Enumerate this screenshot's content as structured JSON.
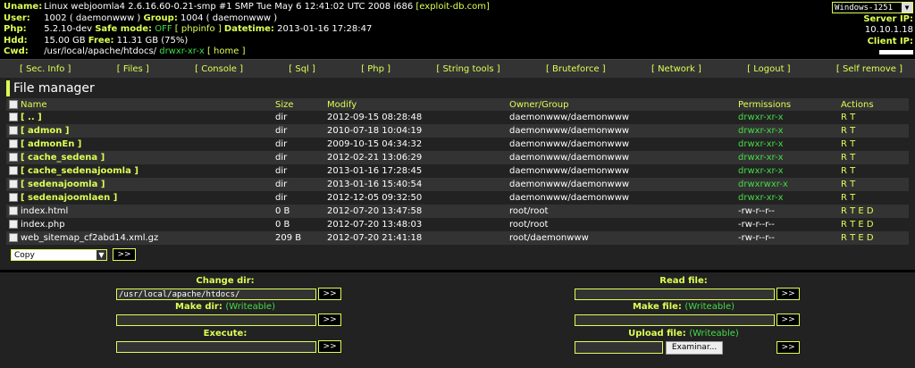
{
  "header": {
    "uname_label": "Uname:",
    "uname_value": "Linux webjoomla4 2.6.16.60-0.21-smp #1 SMP Tue May 6 12:41:02 UTC 2008 i686",
    "uname_link": "[exploit-db.com]",
    "user_label": "User:",
    "user_value": "1002 ( daemonwww )",
    "group_label": "Group:",
    "group_value": "1004 ( daemonwww )",
    "php_label": "Php:",
    "php_value": "5.2.10-dev",
    "safemode_label": "Safe mode:",
    "safemode_value": "OFF",
    "phpinfo_link": "[ phpinfo ]",
    "datetime_label": "Datetime:",
    "datetime_value": "2013-01-16 17:28:47",
    "hdd_label": "Hdd:",
    "hdd_total": "15.00 GB",
    "free_label": "Free:",
    "hdd_free": "11.31 GB (75%)",
    "cwd_label": "Cwd:",
    "cwd_path": "/usr/local/apache/htdocs/",
    "cwd_perms": "drwxr-xr-x",
    "home_link": "[ home ]",
    "charset": "Windows-1251",
    "server_ip_label": "Server IP:",
    "server_ip": "10.10.1.18",
    "client_ip_label": "Client IP:"
  },
  "menu": [
    "[ Sec. Info ]",
    "[ Files ]",
    "[ Console ]",
    "[ Sql ]",
    "[ Php ]",
    "[ String tools ]",
    "[ Bruteforce ]",
    "[ Network ]",
    "[ Logout ]",
    "[ Self remove ]"
  ],
  "file_manager": {
    "title": "File manager",
    "columns": [
      "Name",
      "Size",
      "Modify",
      "Owner/Group",
      "Permissions",
      "Actions"
    ],
    "rows": [
      {
        "name": "[ .. ]",
        "type": "dir",
        "size": "dir",
        "modify": "2012-09-15 08:28:48",
        "owner": "daemonwww/daemonwww",
        "perms": "drwxr-xr-x",
        "actions": "R T"
      },
      {
        "name": "[ admon ]",
        "type": "dir",
        "size": "dir",
        "modify": "2010-07-18 10:04:19",
        "owner": "daemonwww/daemonwww",
        "perms": "drwxr-xr-x",
        "actions": "R T"
      },
      {
        "name": "[ admonEn ]",
        "type": "dir",
        "size": "dir",
        "modify": "2009-10-15 04:34:32",
        "owner": "daemonwww/daemonwww",
        "perms": "drwxr-xr-x",
        "actions": "R T"
      },
      {
        "name": "[ cache_sedena ]",
        "type": "dir",
        "size": "dir",
        "modify": "2012-02-21 13:06:29",
        "owner": "daemonwww/daemonwww",
        "perms": "drwxr-xr-x",
        "actions": "R T"
      },
      {
        "name": "[ cache_sedenajoomla ]",
        "type": "dir",
        "size": "dir",
        "modify": "2013-01-16 17:28:45",
        "owner": "daemonwww/daemonwww",
        "perms": "drwxr-xr-x",
        "actions": "R T"
      },
      {
        "name": "[ sedenajoomla ]",
        "type": "dir",
        "size": "dir",
        "modify": "2013-01-16 15:40:54",
        "owner": "daemonwww/daemonwww",
        "perms": "drwxrwxr-x",
        "actions": "R T"
      },
      {
        "name": "[ sedenajoomlaen ]",
        "type": "dir",
        "size": "dir",
        "modify": "2012-12-05 09:32:50",
        "owner": "daemonwww/daemonwww",
        "perms": "drwxr-xr-x",
        "actions": "R T"
      },
      {
        "name": "index.html",
        "type": "file",
        "size": "0 B",
        "modify": "2012-07-20 13:47:58",
        "owner": "root/root",
        "perms": "-rw-r--r--",
        "actions": "R T E D"
      },
      {
        "name": "index.php",
        "type": "file",
        "size": "0 B",
        "modify": "2012-07-20 13:48:03",
        "owner": "root/root",
        "perms": "-rw-r--r--",
        "actions": "R T E D"
      },
      {
        "name": "web_sitemap_cf2abd14.xml.gz",
        "type": "file",
        "size": "209 B",
        "modify": "2012-07-20 21:41:18",
        "owner": "root/daemonwww",
        "perms": "-rw-r--r--",
        "actions": "R T E D"
      }
    ],
    "action_select": "Copy",
    "submit_label": ">>"
  },
  "forms": {
    "change_dir_label": "Change dir:",
    "change_dir_value": "/usr/local/apache/htdocs/",
    "make_dir_label": "Make dir:",
    "make_dir_note": "(Writeable)",
    "execute_label": "Execute:",
    "read_file_label": "Read file:",
    "make_file_label": "Make file:",
    "make_file_note": "(Writeable)",
    "upload_file_label": "Upload file:",
    "upload_file_note": "(Writeable)",
    "browse_label": "Examinar...",
    "submit_label": ">>"
  },
  "colors": {
    "accent": "#ddff55",
    "writeable": "#44dd44",
    "background": "#222222"
  }
}
